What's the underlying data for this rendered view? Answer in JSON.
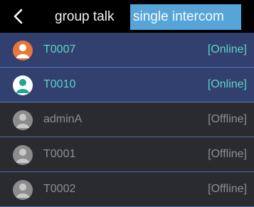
{
  "header": {
    "back_icon": "chevron-left-icon",
    "tabs": [
      {
        "label": "group talk",
        "active": false
      },
      {
        "label": "single intercom",
        "active": true
      }
    ]
  },
  "colors": {
    "online_text": "#5fd3c4",
    "offline_text": "#8c8e93",
    "active_tab_bg": "#57a4d8",
    "online_row_bg": "#31406f",
    "avatar_orange": "#e8773a",
    "avatar_teal": "#20a78e",
    "avatar_gray": "#8c8c8c"
  },
  "contacts": [
    {
      "name": "T0007",
      "status": "[Online]",
      "avatar_color": "orange"
    },
    {
      "name": "T0010",
      "status": "[Online]",
      "avatar_color": "teal"
    },
    {
      "name": "adminA",
      "status": "[Offline]",
      "avatar_color": "gray"
    },
    {
      "name": "T0001",
      "status": "[Offline]",
      "avatar_color": "gray"
    },
    {
      "name": "T0002",
      "status": "[Offline]",
      "avatar_color": "gray"
    }
  ]
}
